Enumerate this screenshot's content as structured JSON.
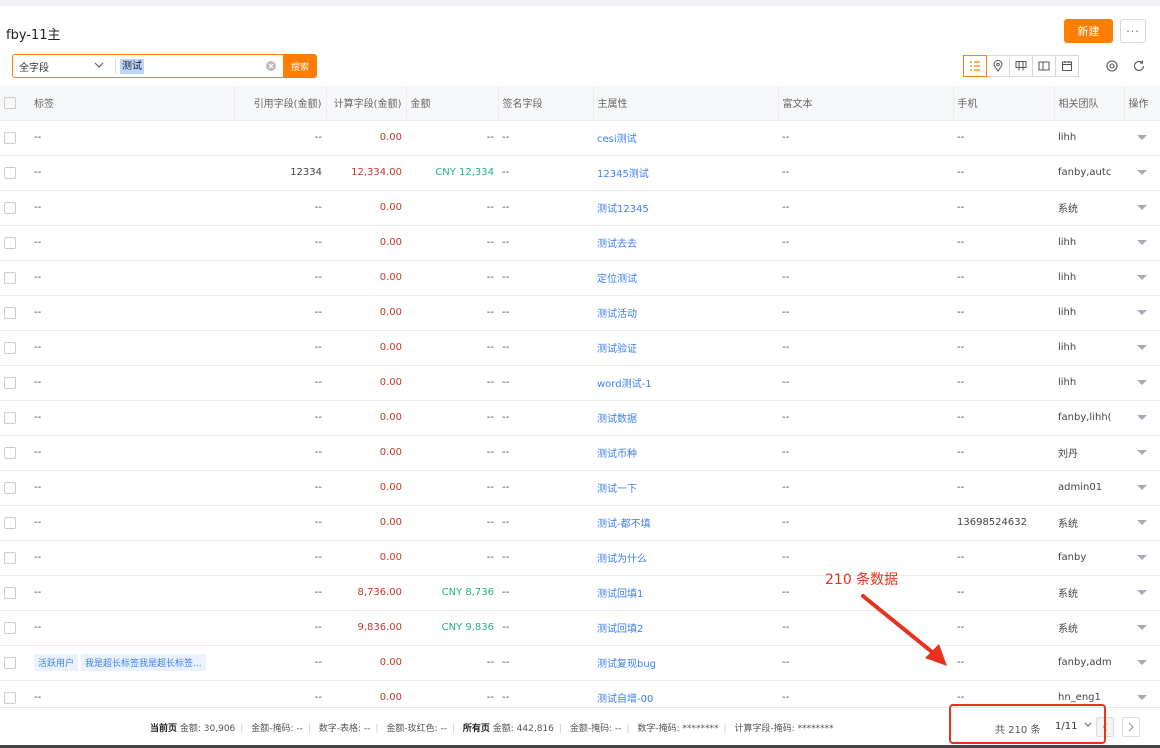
{
  "header": {
    "title": "fby-11主",
    "new_label": "新建",
    "more_label": "···"
  },
  "search": {
    "field": "全字段",
    "value": "测试",
    "button": "搜索"
  },
  "view_icons": [
    "list-view-icon",
    "map-view-icon",
    "kanban-view-icon",
    "card-view-icon",
    "calendar-view-icon"
  ],
  "tools": [
    "settings-icon",
    "refresh-icon"
  ],
  "columns": [
    "标签",
    "引用字段(金额)",
    "计算字段(金额)",
    "金额",
    "签名字段",
    "主属性",
    "富文本",
    "手机",
    "相关团队",
    "操作"
  ],
  "rows": [
    {
      "tag": "--",
      "ref": "--",
      "calc": "0.00",
      "amount": "--",
      "sign": "--",
      "main": "cesi测试",
      "rich": "--",
      "phone": "--",
      "team": "lihh"
    },
    {
      "tag": "--",
      "ref": "12334",
      "calc": "12,334.00",
      "amount": "CNY 12,334",
      "sign": "--",
      "main": "12345测试",
      "rich": "--",
      "phone": "--",
      "team": "fanby,autc"
    },
    {
      "tag": "--",
      "ref": "--",
      "calc": "0.00",
      "amount": "--",
      "sign": "--",
      "main": "测试12345",
      "rich": "--",
      "phone": "--",
      "team": "系统"
    },
    {
      "tag": "--",
      "ref": "--",
      "calc": "0.00",
      "amount": "--",
      "sign": "--",
      "main": "测试去去",
      "rich": "--",
      "phone": "--",
      "team": "lihh"
    },
    {
      "tag": "--",
      "ref": "--",
      "calc": "0.00",
      "amount": "--",
      "sign": "--",
      "main": "定位测试",
      "rich": "--",
      "phone": "--",
      "team": "lihh"
    },
    {
      "tag": "--",
      "ref": "--",
      "calc": "0.00",
      "amount": "--",
      "sign": "--",
      "main": "测试活动",
      "rich": "--",
      "phone": "--",
      "team": "lihh"
    },
    {
      "tag": "--",
      "ref": "--",
      "calc": "0.00",
      "amount": "--",
      "sign": "--",
      "main": "测试验证",
      "rich": "--",
      "phone": "--",
      "team": "lihh"
    },
    {
      "tag": "--",
      "ref": "--",
      "calc": "0.00",
      "amount": "--",
      "sign": "--",
      "main": "word测试-1",
      "rich": "--",
      "phone": "--",
      "team": "lihh"
    },
    {
      "tag": "--",
      "ref": "--",
      "calc": "0.00",
      "amount": "--",
      "sign": "--",
      "main": "测试数据",
      "rich": "--",
      "phone": "--",
      "team": "fanby,lihh("
    },
    {
      "tag": "--",
      "ref": "--",
      "calc": "0.00",
      "amount": "--",
      "sign": "--",
      "main": "测试币种",
      "rich": "--",
      "phone": "--",
      "team": "刘丹"
    },
    {
      "tag": "--",
      "ref": "--",
      "calc": "0.00",
      "amount": "--",
      "sign": "--",
      "main": "测试一下",
      "rich": "--",
      "phone": "--",
      "team": "admin01"
    },
    {
      "tag": "--",
      "ref": "--",
      "calc": "0.00",
      "amount": "--",
      "sign": "--",
      "main": "测试-都不填",
      "rich": "--",
      "phone": "13698524632",
      "team": "系统"
    },
    {
      "tag": "--",
      "ref": "--",
      "calc": "0.00",
      "amount": "--",
      "sign": "--",
      "main": "测试为什么",
      "rich": "--",
      "phone": "--",
      "team": "fanby"
    },
    {
      "tag": "--",
      "ref": "--",
      "calc": "8,736.00",
      "amount": "CNY 8,736",
      "sign": "--",
      "main": "测试回填1",
      "rich": "--",
      "phone": "--",
      "team": "系统"
    },
    {
      "tag": "--",
      "ref": "--",
      "calc": "9,836.00",
      "amount": "CNY 9,836",
      "sign": "--",
      "main": "测试回填2",
      "rich": "--",
      "phone": "--",
      "team": "系统"
    },
    {
      "tags": [
        "活跃用户",
        "我是超长标签我是超长标签..."
      ],
      "ref": "--",
      "calc": "0.00",
      "amount": "--",
      "sign": "--",
      "main": "测试复现bug",
      "rich": "--",
      "phone": "--",
      "team": "fanby,adm"
    },
    {
      "tag": "--",
      "ref": "--",
      "calc": "0.00",
      "amount": "--",
      "sign": "--",
      "main": "测试自增-00",
      "rich": "--",
      "phone": "--",
      "team": "hn_eng1"
    }
  ],
  "footer": {
    "current_page_label": "当前页",
    "current": [
      "金额: 30,906",
      "金额-掩码: --",
      "数字-表格: --",
      "金额-玫红色: --"
    ],
    "all_pages_label": "所有页",
    "all": [
      "金额: 442,816",
      "金额-掩码: --",
      "数字-掩码: ********",
      "计算字段-掩码: ********"
    ],
    "total": "共 210 条",
    "page": "1/11"
  },
  "annotation": {
    "text": "210 条数据",
    "color": "#e8321e"
  },
  "colors": {
    "accent": "#ff7d00",
    "link": "#3d7ef5",
    "calc_red": "#c0392b",
    "amount_green": "#22b08c"
  }
}
